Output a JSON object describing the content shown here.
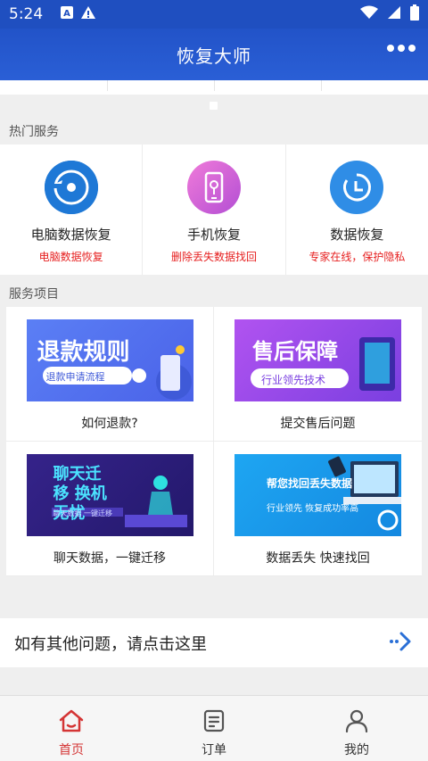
{
  "status_bar": {
    "time": "5:24"
  },
  "app_bar": {
    "title": "恢复大师"
  },
  "hot_section": {
    "title": "热门服务",
    "items": [
      {
        "name": "电脑数据恢复",
        "sub": "电脑数据恢复",
        "icon": "disc-restore-icon",
        "color": "#1f7ad8"
      },
      {
        "name": "手机恢复",
        "sub": "删除丢失数据找回",
        "icon": "phone-icon",
        "color": "#c94fd6"
      },
      {
        "name": "数据恢复",
        "sub": "专家在线，保护隐私",
        "icon": "clock-icon",
        "color": "#2f8de6"
      }
    ]
  },
  "service_section": {
    "title": "服务项目",
    "items": [
      {
        "label": "如何退款?",
        "card_title": "退款规则",
        "card_sub": "退款申请流程"
      },
      {
        "label": "提交售后问题",
        "card_title": "售后保障",
        "card_sub": "行业领先技术"
      },
      {
        "label": "聊天数据，一键迁移",
        "card_title": "聊天迁移 换机无忧",
        "card_sub": "聊天数据 一键迁移"
      },
      {
        "label": "数据丢失 快速找回",
        "card_title": "帮您找回丢失数据",
        "card_sub": "行业领先 恢复成功率高"
      }
    ]
  },
  "contact": {
    "text": "如有其他问题，请点击这里"
  },
  "tab_bar": {
    "tabs": [
      {
        "label": "首页",
        "icon": "home-icon",
        "active": true
      },
      {
        "label": "订单",
        "icon": "order-icon",
        "active": false
      },
      {
        "label": "我的",
        "icon": "user-icon",
        "active": false
      }
    ]
  },
  "colors": {
    "primary": "#2253c8",
    "accent_red": "#e62020"
  }
}
